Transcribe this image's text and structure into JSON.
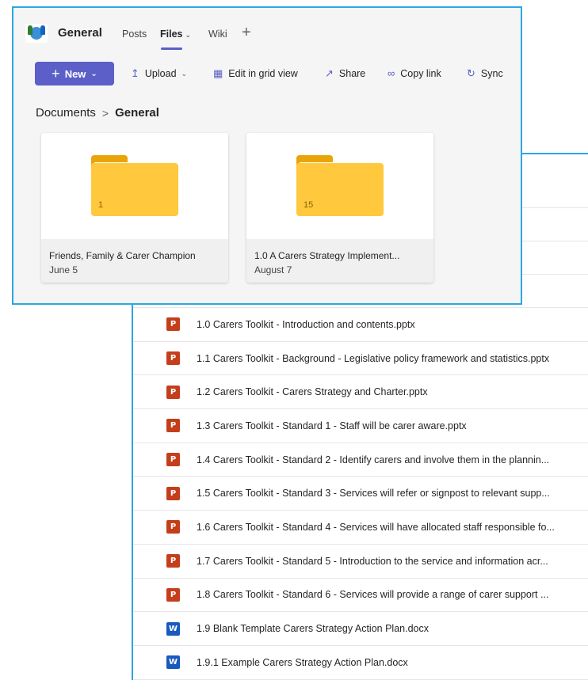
{
  "team": {
    "name": "General"
  },
  "tabs": [
    {
      "label": "Posts"
    },
    {
      "label": "Files"
    },
    {
      "label": "Wiki"
    }
  ],
  "toolbar": {
    "new_label": "New",
    "upload_label": "Upload",
    "grid_label": "Edit in grid view",
    "share_label": "Share",
    "copylink_label": "Copy link",
    "sync_label": "Sync"
  },
  "breadcrumb": {
    "root": "Documents",
    "current": "General"
  },
  "folders": [
    {
      "name": "Friends, Family & Carer Champion",
      "date": "June 5",
      "count": "1"
    },
    {
      "name": "1.0 A Carers Strategy Implement...",
      "date": "August 7",
      "count": "15"
    }
  ],
  "files": [
    {
      "type": "pptx",
      "icon": "powerpoint-icon",
      "name": "1.0  Carers Toolkit - Introduction and contents.pptx"
    },
    {
      "type": "pptx",
      "icon": "powerpoint-icon",
      "name": "1.1  Carers Toolkit - Background - Legislative policy framework and statistics.pptx"
    },
    {
      "type": "pptx",
      "icon": "powerpoint-icon",
      "name": "1.2  Carers Toolkit -  Carers Strategy and Charter.pptx"
    },
    {
      "type": "pptx",
      "icon": "powerpoint-icon",
      "name": "1.3  Carers Toolkit - Standard 1 - Staff will be carer aware.pptx"
    },
    {
      "type": "pptx",
      "icon": "powerpoint-icon",
      "name": "1.4  Carers Toolkit - Standard 2 - Identify carers and involve them in the plannin..."
    },
    {
      "type": "pptx",
      "icon": "powerpoint-icon",
      "name": "1.5  Carers Toolkit - Standard 3 - Services will refer or signpost to relevant supp..."
    },
    {
      "type": "pptx",
      "icon": "powerpoint-icon",
      "name": "1.6  Carers Toolkit - Standard 4 - Services will have allocated staff responsible fo..."
    },
    {
      "type": "pptx",
      "icon": "powerpoint-icon",
      "name": "1.7  Carers Toolkit - Standard 5 - Introduction to the service and information acr..."
    },
    {
      "type": "pptx",
      "icon": "powerpoint-icon",
      "name": "1.8  Carers Toolkit - Standard 6 - Services will provide a range of carer support ..."
    },
    {
      "type": "docx",
      "icon": "word-icon",
      "name": "1.9  Blank Template Carers Strategy Action Plan.docx"
    },
    {
      "type": "docx",
      "icon": "word-icon",
      "name": "1.9.1 Example Carers Strategy Action Plan.docx"
    }
  ],
  "colors": {
    "accent": "#5b5fc7",
    "frame": "#2aa7e3",
    "folder": "#ffc83d",
    "ppt": "#c43e1c",
    "word": "#185abd"
  }
}
